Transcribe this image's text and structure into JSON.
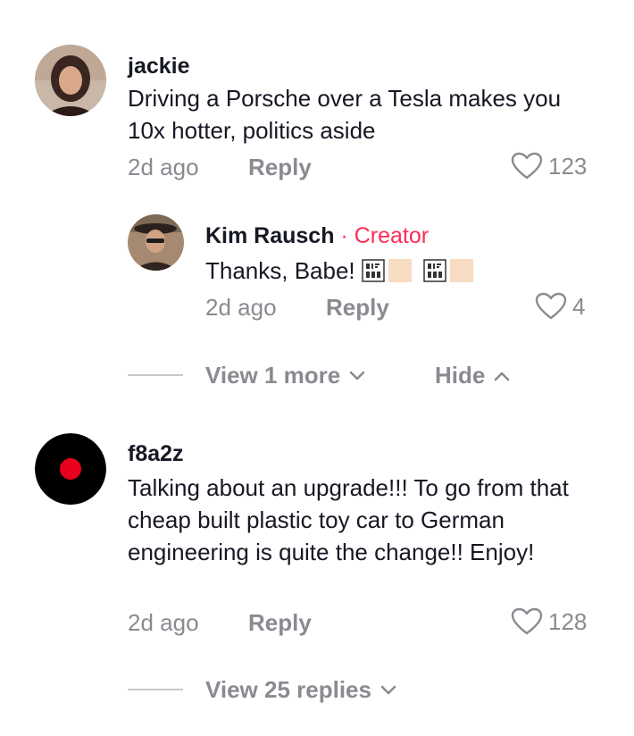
{
  "comments": [
    {
      "username": "jackie",
      "text": "Driving a Porsche over a Tesla makes you 10x hotter, politics aside",
      "time": "2d ago",
      "reply_label": "Reply",
      "likes": "123",
      "avatar_icon": "profile-photo-avatar"
    },
    {
      "username": "f8a2z",
      "text": "Talking about an upgrade!!! To go from that cheap built plastic toy car to German engineering is quite the change!! Enjoy!",
      "time": "2d ago",
      "reply_label": "Reply",
      "likes": "128",
      "avatar_icon": "red-dot-avatar"
    }
  ],
  "reply": {
    "username": "Kim Rausch",
    "creator_sep": " · ",
    "creator_label": "Creator",
    "text": "Thanks, Babe!",
    "time": "2d ago",
    "reply_label": "Reply",
    "likes": "4"
  },
  "thread_controls": {
    "view_more": "View 1 more",
    "hide": "Hide",
    "view_replies": "View 25 replies"
  },
  "colors": {
    "accent": "#fe2c55",
    "muted": "#8a8b91",
    "text": "#161823"
  }
}
